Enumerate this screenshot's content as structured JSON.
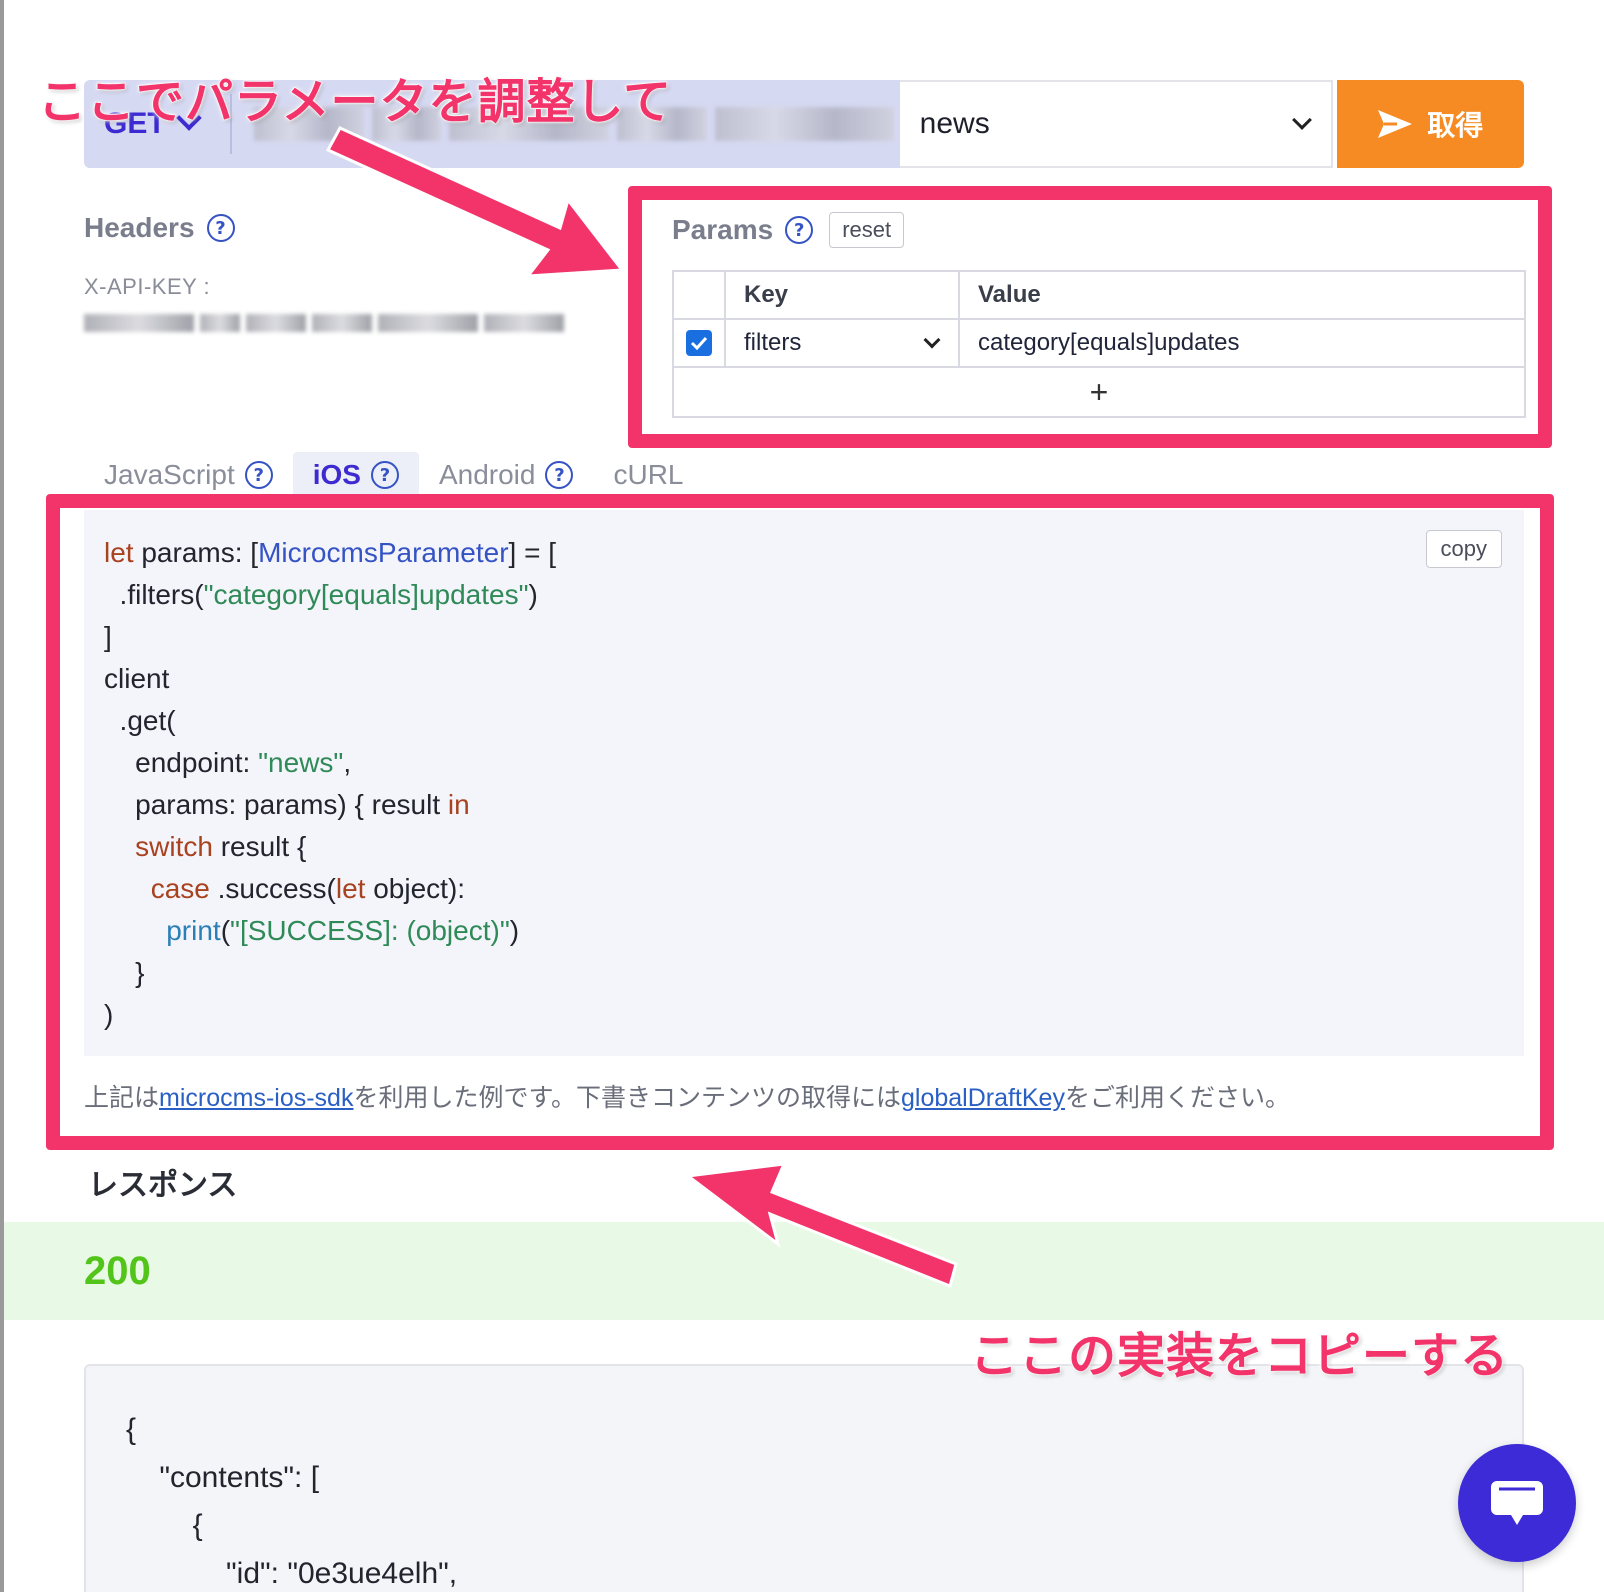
{
  "request": {
    "method": "GET",
    "endpoint_select": "news",
    "send_label": "取得"
  },
  "headers": {
    "title": "Headers",
    "api_key_label": "X-API-KEY :"
  },
  "params": {
    "title": "Params",
    "reset_label": "reset",
    "columns": [
      "Key",
      "Value"
    ],
    "rows": [
      {
        "checked": true,
        "key": "filters",
        "value": "category[equals]updates"
      }
    ],
    "add_label": "+"
  },
  "tabs": [
    {
      "label": "JavaScript",
      "active": false
    },
    {
      "label": "iOS",
      "active": true
    },
    {
      "label": "Android",
      "active": false
    },
    {
      "label": "cURL",
      "active": false
    }
  ],
  "code": {
    "copy_label": "copy",
    "lines": {
      "l1_let": "let",
      "l1_mid": " params: [",
      "l1_type": "MicrocmsParameter",
      "l1_end": "] = [",
      "l2_a": "  .filters(",
      "l2_str": "\"category[equals]updates\"",
      "l2_b": ")",
      "l3": "]",
      "l4": "client",
      "l5": "  .get(",
      "l6_a": "    endpoint: ",
      "l6_str": "\"news\"",
      "l6_b": ",",
      "l7_a": "    params: params) { result ",
      "l7_in": "in",
      "l8_switch": "switch",
      "l8_b": " result {",
      "l9_case": "case",
      "l9_b": " .success(",
      "l9_let": "let",
      "l9_c": " object):",
      "l10_print": "print",
      "l10_a": "(",
      "l10_str": "\"[SUCCESS]: (object)\"",
      "l10_b": ")",
      "l11": "    }",
      "l12": ")"
    },
    "note_prefix": "上記は",
    "note_link1": "microcms-ios-sdk",
    "note_mid": "を利用した例です。下書きコンテンツの取得には",
    "note_link2": "globalDraftKey",
    "note_suffix": "をご利用ください。"
  },
  "response": {
    "title": "レスポンス",
    "status": "200",
    "body_lines": [
      "{",
      "    \"contents\": [",
      "        {",
      "            \"id\": \"0e3ue4elh\","
    ]
  },
  "annotations": {
    "top": "ここでパラメータを調整して",
    "bottom": "ここの実装をコピーする"
  },
  "colors": {
    "accent": "#3d2bd1",
    "send": "#f58b22",
    "highlight": "#f2346b",
    "status_ok": "#52c41a"
  },
  "icons": [
    "chevron-down-icon",
    "send-icon",
    "help-icon",
    "checkbox-checked-icon",
    "chat-icon"
  ]
}
